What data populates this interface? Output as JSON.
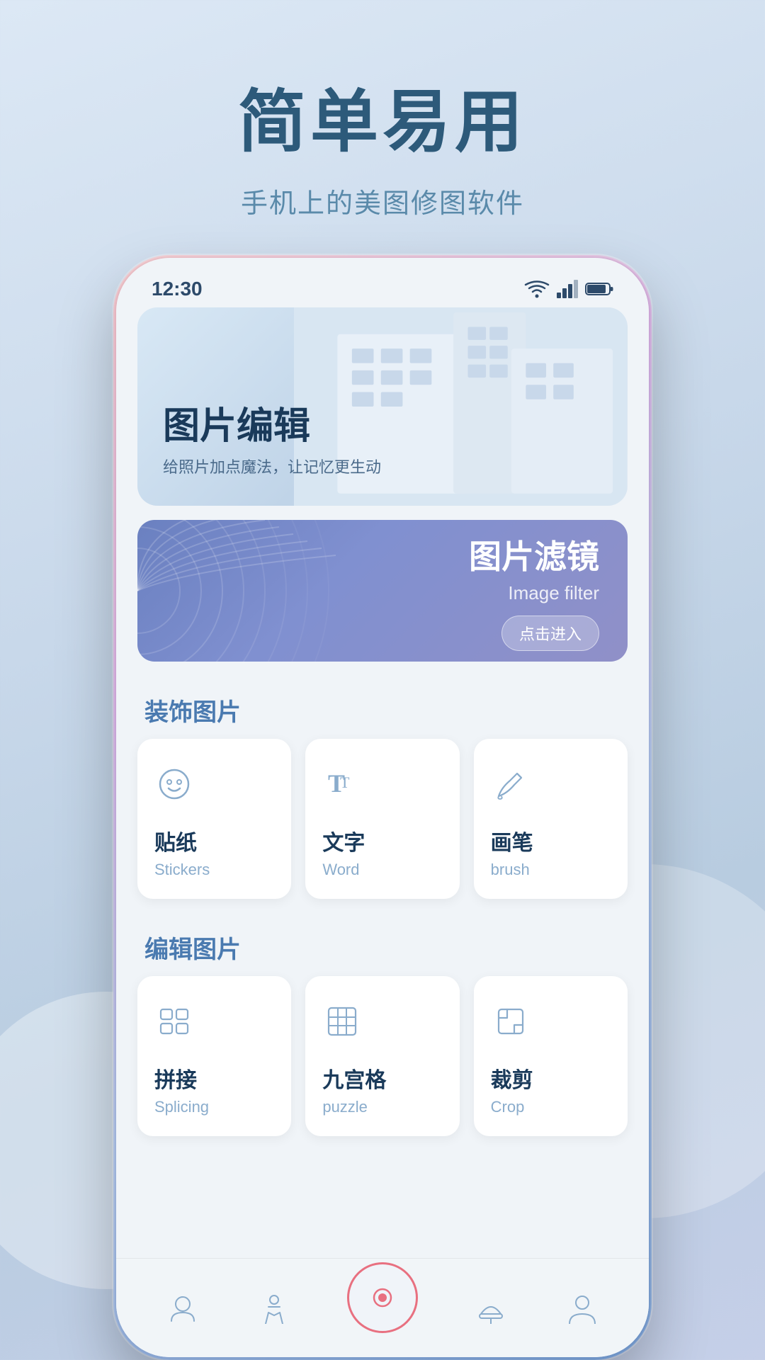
{
  "page": {
    "background": "#dce8f5"
  },
  "hero": {
    "title": "简单易用",
    "subtitle": "手机上的美图修图软件"
  },
  "phone": {
    "statusBar": {
      "time": "12:30"
    },
    "banner": {
      "title": "图片编辑",
      "subtitle": "给照片加点魔法，让记忆更生动"
    },
    "filterCard": {
      "title": "图片滤镜",
      "subtitle": "Image filter",
      "buttonLabel": "点击进入"
    },
    "decorateSection": {
      "label_prefix": "装饰",
      "label_suffix": "图片",
      "features": [
        {
          "icon": "sticker-icon",
          "nameCn": "贴纸",
          "nameEn": "Stickers"
        },
        {
          "icon": "text-icon",
          "nameCn": "文字",
          "nameEn": "Word"
        },
        {
          "icon": "brush-icon",
          "nameCn": "画笔",
          "nameEn": "brush"
        }
      ]
    },
    "editSection": {
      "label_prefix": "编辑",
      "label_suffix": "图片",
      "features": [
        {
          "icon": "splice-icon",
          "nameCn": "拼接",
          "nameEn": "Splicing"
        },
        {
          "icon": "grid-icon",
          "nameCn": "九宫格",
          "nameEn": "puzzle"
        },
        {
          "icon": "crop-icon",
          "nameCn": "裁剪",
          "nameEn": "Crop"
        }
      ]
    },
    "bottomNav": [
      {
        "icon": "face-icon",
        "label": ""
      },
      {
        "icon": "figure-icon",
        "label": ""
      },
      {
        "icon": "center-icon",
        "label": ""
      },
      {
        "icon": "hat-icon",
        "label": ""
      },
      {
        "icon": "person-icon",
        "label": ""
      }
    ]
  }
}
